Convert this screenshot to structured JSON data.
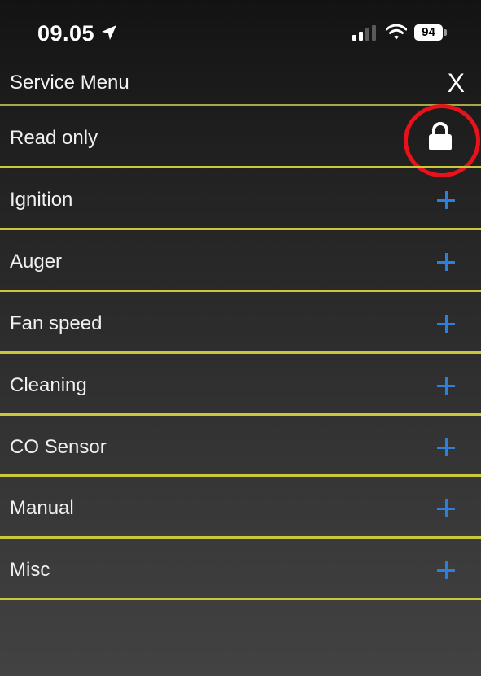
{
  "status_bar": {
    "time": "09.05",
    "battery_level": "94",
    "icons": [
      "location-arrow-icon",
      "cellular-signal-icon",
      "wifi-icon",
      "battery-icon"
    ]
  },
  "header": {
    "title": "Service Menu",
    "close_label": "X"
  },
  "read_only": {
    "label": "Read only",
    "icon": "lock-icon",
    "highlight_color": "#e8121a"
  },
  "menu_items": [
    {
      "label": "Ignition",
      "icon": "plus-icon"
    },
    {
      "label": "Auger",
      "icon": "plus-icon"
    },
    {
      "label": "Fan speed",
      "icon": "plus-icon"
    },
    {
      "label": "Cleaning",
      "icon": "plus-icon"
    },
    {
      "label": "CO Sensor",
      "icon": "plus-icon"
    },
    {
      "label": "Manual",
      "icon": "plus-icon"
    },
    {
      "label": "Misc",
      "icon": "plus-icon"
    }
  ],
  "colors": {
    "divider": "#c8c83a",
    "plus": "#2f7fd8",
    "text": "#f0f0f0"
  }
}
